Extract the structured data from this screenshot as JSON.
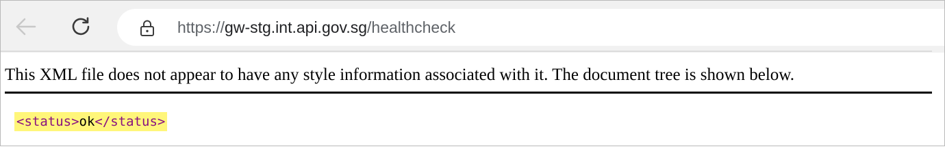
{
  "browser": {
    "url_prefix": "https://",
    "url_host": "gw-stg.int.api.gov.sg",
    "url_path": "/healthcheck",
    "icons": {
      "back": "back-arrow-icon",
      "reload": "reload-icon",
      "site_info": "lock-icon"
    }
  },
  "page": {
    "notice": "This XML file does not appear to have any style information associated with it. The document tree is shown below.",
    "xml": {
      "open_tag": "<status>",
      "value": "ok",
      "close_tag": "</status>"
    }
  },
  "colors": {
    "highlight": "#fff67a",
    "tag": "#881280",
    "toolbar": "#f1f1f1"
  }
}
